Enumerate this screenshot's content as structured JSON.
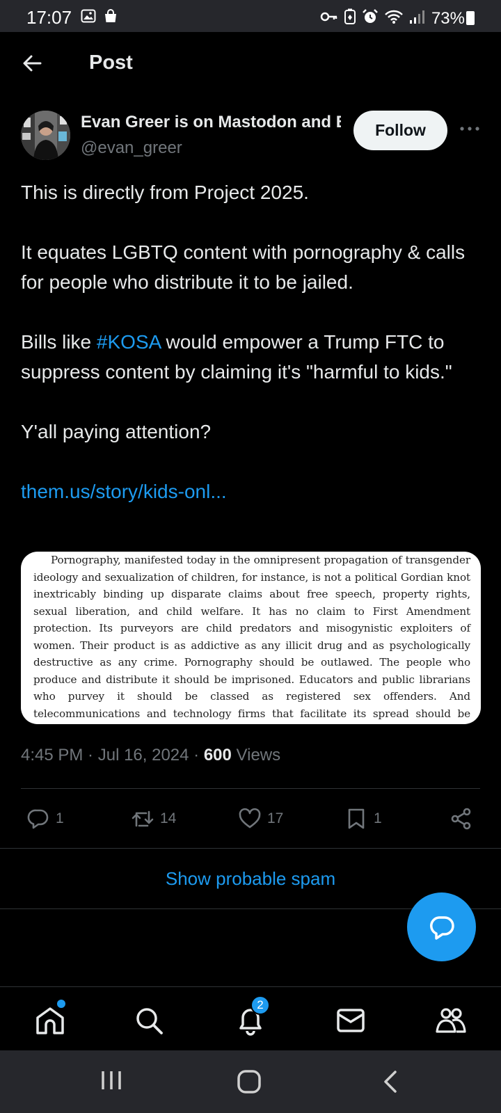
{
  "status_bar": {
    "time": "17:07",
    "battery": "73%",
    "left_icons": [
      "image-icon",
      "shopping-bag-icon"
    ],
    "right_icons": [
      "vpn-key-icon",
      "battery-saver-icon",
      "alarm-icon",
      "wifi-icon",
      "signal-icon",
      "battery-icon"
    ]
  },
  "header": {
    "title": "Post",
    "back_icon": "arrow-left-icon"
  },
  "author": {
    "name": "Evan Greer is on Mastodon and Bluesky",
    "handle": "@evan_greer",
    "follow_label": "Follow",
    "more_label": "···"
  },
  "post": {
    "line1": "This is directly from Project 2025.",
    "line2": "It equates LGBTQ content with pornography & calls for people who distribute it to be jailed.",
    "line3_before": "Bills like ",
    "hashtag": "#KOSA",
    "line3_after": " would empower a Trump FTC to suppress content by claiming it's \"harmful to kids.\"",
    "line4": "Y'all paying attention?",
    "link": "them.us/story/kids-onl..."
  },
  "media": {
    "quote": "Pornography, manifested today in the omnipresent propagation of transgender ideology and sexualization of children, for instance, is not a political Gordian knot inextricably binding up disparate claims about free speech, property rights, sexual liberation, and child welfare. It has no claim to First Amendment protection. Its purveyors are child predators and misogynistic exploiters of women. Their product is as addictive as any illicit drug and as psychologically destructive as any crime. Pornography should be outlawed. The people who produce and distribute it should be imprisoned. Educators and public librarians who purvey it should be classed as registered sex offenders. And telecommunications and technology firms that facilitate its spread should be shuttered."
  },
  "meta": {
    "time": "4:45 PM",
    "sep": " · ",
    "date": "Jul 16, 2024",
    "views_count": "600",
    "views_label": " Views"
  },
  "actions": {
    "replies": "1",
    "reposts": "14",
    "likes": "17",
    "bookmarks": "1"
  },
  "spam_button": "Show probable spam",
  "bottom_nav": {
    "items": [
      "home-icon",
      "search-icon",
      "notifications-icon",
      "messages-icon",
      "communities-icon"
    ],
    "notifications_badge": "2"
  },
  "colors": {
    "accent": "#1d9bf0",
    "background": "#000000",
    "text": "#e7e9ea",
    "muted": "#71767b"
  }
}
